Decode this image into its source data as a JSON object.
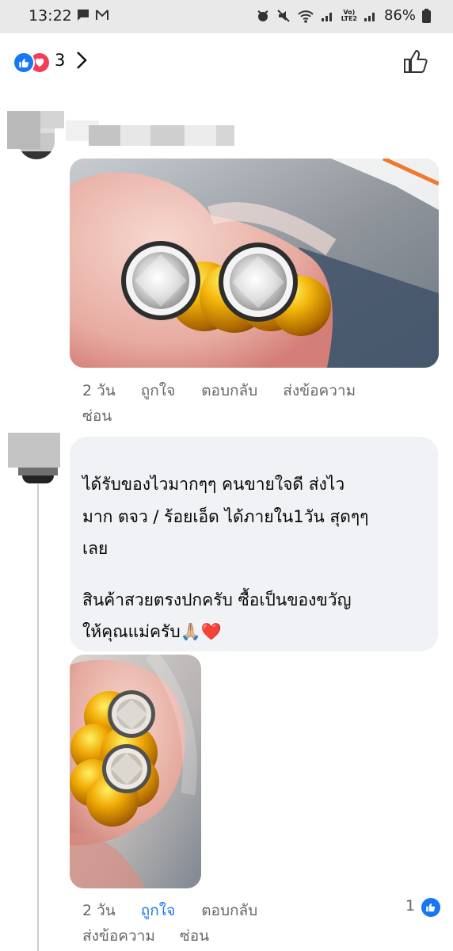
{
  "status_bar": {
    "time": "13:22",
    "battery": "86%",
    "network_label_top": "Vo)",
    "network_label_bottom": "LTE2"
  },
  "reactions": {
    "count": "3",
    "icons": [
      "like-reaction-icon",
      "love-reaction-icon",
      "chevron-right-icon",
      "thumbs-up-icon"
    ]
  },
  "comments": [
    {
      "author_visible": false,
      "has_photo": true,
      "time": "2 วัน",
      "like": "ถูกใจ",
      "reply": "ตอบกลับ",
      "message": "ส่งข้อความ",
      "hide": "ซ่อน"
    },
    {
      "author_visible": false,
      "text_lines": [
        "ได้รับของไวมากๆๆ คนขายใจดี ส่งไว",
        "มาก ตจว / ร้อยเอ็ด ได้ภายใน1วัน สุดๆๆ",
        "เลย",
        "",
        "สินค้าสวยตรงปกครับ ซื้อเป็นของขวัญ",
        "ให้คุณแม่ครับ🙏🏼❤️"
      ],
      "has_photo": true,
      "time": "2 วัน",
      "like": "ถูกใจ",
      "reply": "ตอบกลับ",
      "message": "ส่งข้อความ",
      "hide": "ซ่อน",
      "like_count": "1",
      "liked_color": "#1877f2"
    }
  ]
}
